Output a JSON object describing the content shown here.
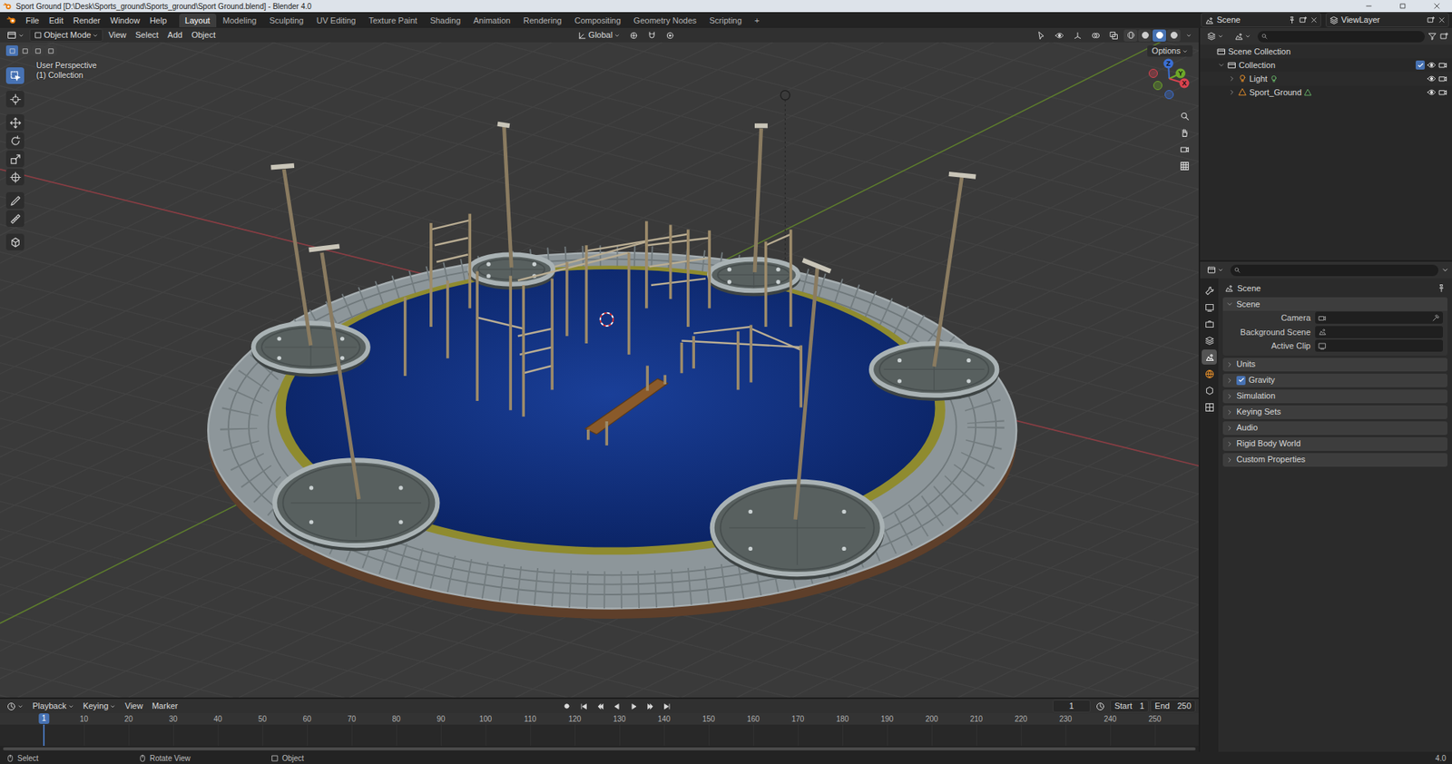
{
  "window": {
    "title": "Sport Ground [D:\\Desk\\Sports_ground\\Sports_ground\\Sport Ground.blend] - Blender 4.0"
  },
  "menu": [
    "File",
    "Edit",
    "Render",
    "Window",
    "Help"
  ],
  "workspaces": [
    {
      "label": "Layout",
      "selected": true
    },
    {
      "label": "Modeling",
      "selected": false
    },
    {
      "label": "Sculpting",
      "selected": false
    },
    {
      "label": "UV Editing",
      "selected": false
    },
    {
      "label": "Texture Paint",
      "selected": false
    },
    {
      "label": "Shading",
      "selected": false
    },
    {
      "label": "Animation",
      "selected": false
    },
    {
      "label": "Rendering",
      "selected": false
    },
    {
      "label": "Compositing",
      "selected": false
    },
    {
      "label": "Geometry Nodes",
      "selected": false
    },
    {
      "label": "Scripting",
      "selected": false
    }
  ],
  "add_workspace": "+",
  "scene_selector": {
    "value": "Scene"
  },
  "view_layer": {
    "value": "ViewLayer"
  },
  "viewport_header": {
    "mode": "Object Mode",
    "menus": [
      "View",
      "Select",
      "Add",
      "Object"
    ],
    "orientation": "Global",
    "options": "Options"
  },
  "viewport": {
    "info": [
      "User Perspective",
      "(1) Collection"
    ],
    "tools": [
      {
        "selected": true
      },
      {
        "selected": false
      },
      {
        "selected": false
      },
      {
        "selected": false
      },
      {
        "selected": false
      },
      {
        "selected": false
      },
      {
        "selected": false
      },
      {
        "selected": false
      },
      {
        "selected": false
      }
    ],
    "shading": [
      {
        "selected": false
      },
      {
        "selected": false
      },
      {
        "selected": true
      },
      {
        "selected": false
      }
    ]
  },
  "gizmo": {
    "axes": [
      {
        "label": "Z",
        "color": "#3b6fd4"
      },
      {
        "label": "Y",
        "color": "#6ea829"
      },
      {
        "label": "X",
        "color": "#d8434f"
      }
    ]
  },
  "outliner": {
    "items": [
      {
        "label": "Scene Collection",
        "level": 0,
        "kind": "scene"
      },
      {
        "label": "Collection",
        "level": 1,
        "kind": "collection",
        "expanded": true,
        "checked": true
      },
      {
        "label": "Light",
        "level": 2,
        "kind": "light",
        "expanded": false
      },
      {
        "label": "Sport_Ground",
        "level": 2,
        "kind": "mesh",
        "expanded": false
      }
    ]
  },
  "properties": {
    "title": "Scene",
    "tabs": [
      {
        "selected": false
      },
      {
        "selected": false
      },
      {
        "selected": false
      },
      {
        "selected": false
      },
      {
        "selected": true
      },
      {
        "selected": false
      },
      {
        "selected": false
      },
      {
        "selected": false
      }
    ],
    "panel": {
      "label": "Scene",
      "expanded": true,
      "fields": [
        {
          "label": "Camera"
        },
        {
          "label": "Background Scene"
        },
        {
          "label": "Active Clip"
        }
      ]
    },
    "sections": [
      {
        "label": "Units",
        "expanded": false
      },
      {
        "label": "Gravity",
        "expanded": false,
        "checked": true
      },
      {
        "label": "Simulation",
        "expanded": false
      },
      {
        "label": "Keying Sets",
        "expanded": false
      },
      {
        "label": "Audio",
        "expanded": false
      },
      {
        "label": "Rigid Body World",
        "expanded": false
      },
      {
        "label": "Custom Properties",
        "expanded": false
      }
    ]
  },
  "timeline": {
    "menus": [
      "Playback",
      "Keying",
      "View",
      "Marker"
    ],
    "current_frame": "1",
    "start_label": "Start",
    "start": "1",
    "end_label": "End",
    "end": "250",
    "playhead": "1",
    "ticks": [
      "10",
      "20",
      "30",
      "40",
      "50",
      "60",
      "70",
      "80",
      "90",
      "100",
      "110",
      "120",
      "130",
      "140",
      "150",
      "160",
      "170",
      "180",
      "190",
      "200",
      "210",
      "220",
      "230",
      "240",
      "250"
    ]
  },
  "status_bar": {
    "items": [
      "Select",
      "Rotate View",
      "Object"
    ],
    "version": "4.0"
  }
}
